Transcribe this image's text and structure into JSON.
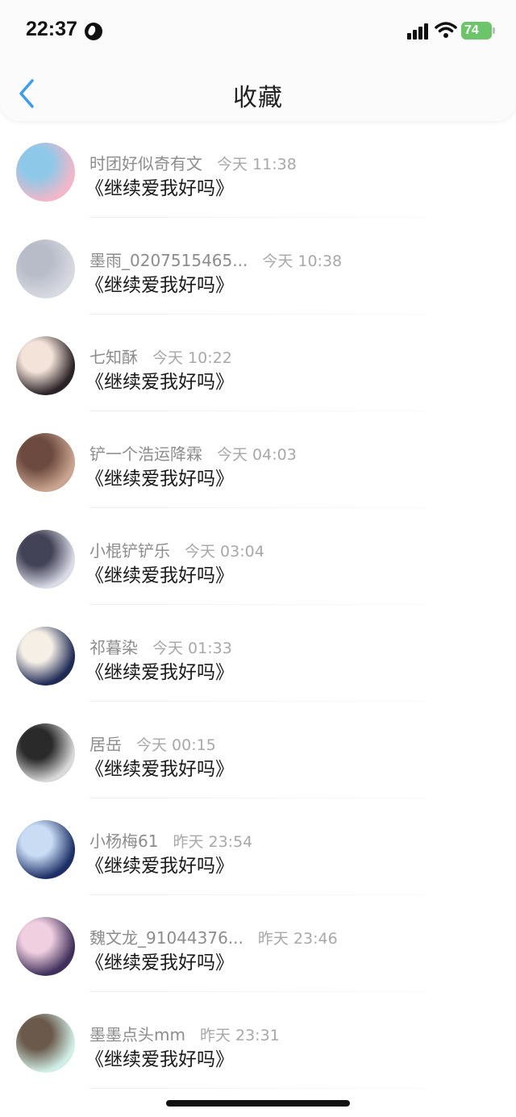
{
  "status_bar": {
    "time": "22:37",
    "battery": "74",
    "battery_color": "#6cc56a",
    "icons": [
      "globe-icon",
      "cellular-signal-icon",
      "wifi-icon",
      "battery-icon"
    ]
  },
  "header": {
    "title": "收藏",
    "back_icon": "chevron-left-icon",
    "accent_color": "#3d9bf0"
  },
  "favorites": [
    {
      "name": "时团好似奇有文",
      "time": "今天 11:38",
      "message": "《继续爱我好吗》",
      "avatar_colors": [
        "#f1b7c8",
        "#8ec8e8"
      ]
    },
    {
      "name": "墨雨_0207515465...",
      "time": "今天 10:38",
      "message": "《继续爱我好吗》",
      "avatar_colors": [
        "#d7d9e0",
        "#b7bcc8"
      ]
    },
    {
      "name": "七知酥",
      "time": "今天 10:22",
      "message": "《继续爱我好吗》",
      "avatar_colors": [
        "#2a2226",
        "#f3e3d9"
      ]
    },
    {
      "name": "铲一个浩运降霖",
      "time": "今天 04:03",
      "message": "《继续爱我好吗》",
      "avatar_colors": [
        "#c9a48f",
        "#6c4a3f"
      ]
    },
    {
      "name": "小棍铲铲乐",
      "time": "今天 03:04",
      "message": "《继续爱我好吗》",
      "avatar_colors": [
        "#d9dbe6",
        "#434357"
      ]
    },
    {
      "name": "祁暮染",
      "time": "今天 01:33",
      "message": "《继续爱我好吗》",
      "avatar_colors": [
        "#1f2a55",
        "#f5efe6"
      ]
    },
    {
      "name": "居岳",
      "time": "今天 00:15",
      "message": "《继续爱我好吗》",
      "avatar_colors": [
        "#d8d8d8",
        "#2a2a2a"
      ]
    },
    {
      "name": "小杨梅61",
      "time": "昨天 23:54",
      "message": "《继续爱我好吗》",
      "avatar_colors": [
        "#1c2f66",
        "#c9dcf4"
      ]
    },
    {
      "name": "魏文龙_91044376...",
      "time": "昨天 23:46",
      "message": "《继续爱我好吗》",
      "avatar_colors": [
        "#3f2f5a",
        "#f0cfe0"
      ]
    },
    {
      "name": "墨墨点头mm",
      "time": "昨天 23:31",
      "message": "《继续爱我好吗》",
      "avatar_colors": [
        "#cfeee6",
        "#6b5a4c"
      ]
    }
  ]
}
